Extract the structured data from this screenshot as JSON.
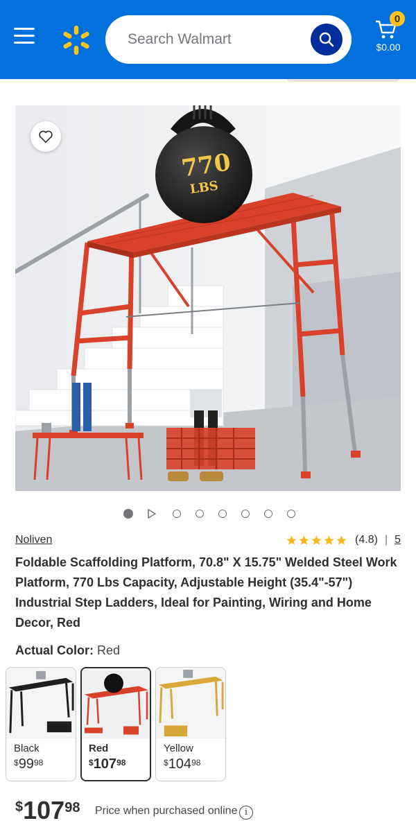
{
  "header": {
    "search_placeholder": "Search Walmart",
    "cart_count": "0",
    "cart_total": "$0.00",
    "brand_color": "#0071dc",
    "accent_color": "#ffc220"
  },
  "product": {
    "image_badge_number": "770",
    "image_badge_unit": "LBS",
    "carousel": {
      "total_images": 7,
      "active_index": 0,
      "has_video": true
    },
    "brand": "Noliven",
    "rating_value": 4.8,
    "rating_text": "(4.8)",
    "review_count": "5",
    "title": "Foldable Scaffolding Platform, 70.8\" X 15.75\" Welded Steel Work Platform, 770 Lbs Capacity, Adjustable Height (35.4\"-57\") Industrial Step Ladders, Ideal for Painting, Wiring and Home Decor, Red",
    "actual_color_label": "Actual Color:",
    "actual_color_value": "Red",
    "variants": [
      {
        "name": "Black",
        "currency": "$",
        "dollars": "99",
        "cents": "98",
        "color": "#1e1e1e",
        "selected": false
      },
      {
        "name": "Red",
        "currency": "$",
        "dollars": "107",
        "cents": "98",
        "color": "#d9412a",
        "selected": true
      },
      {
        "name": "Yellow",
        "currency": "$",
        "dollars": "104",
        "cents": "98",
        "color": "#d8a73a",
        "selected": false
      }
    ],
    "price": {
      "currency": "$",
      "dollars": "107",
      "cents": "98"
    },
    "price_note": "Price when purchased online",
    "info_icon": "i"
  }
}
